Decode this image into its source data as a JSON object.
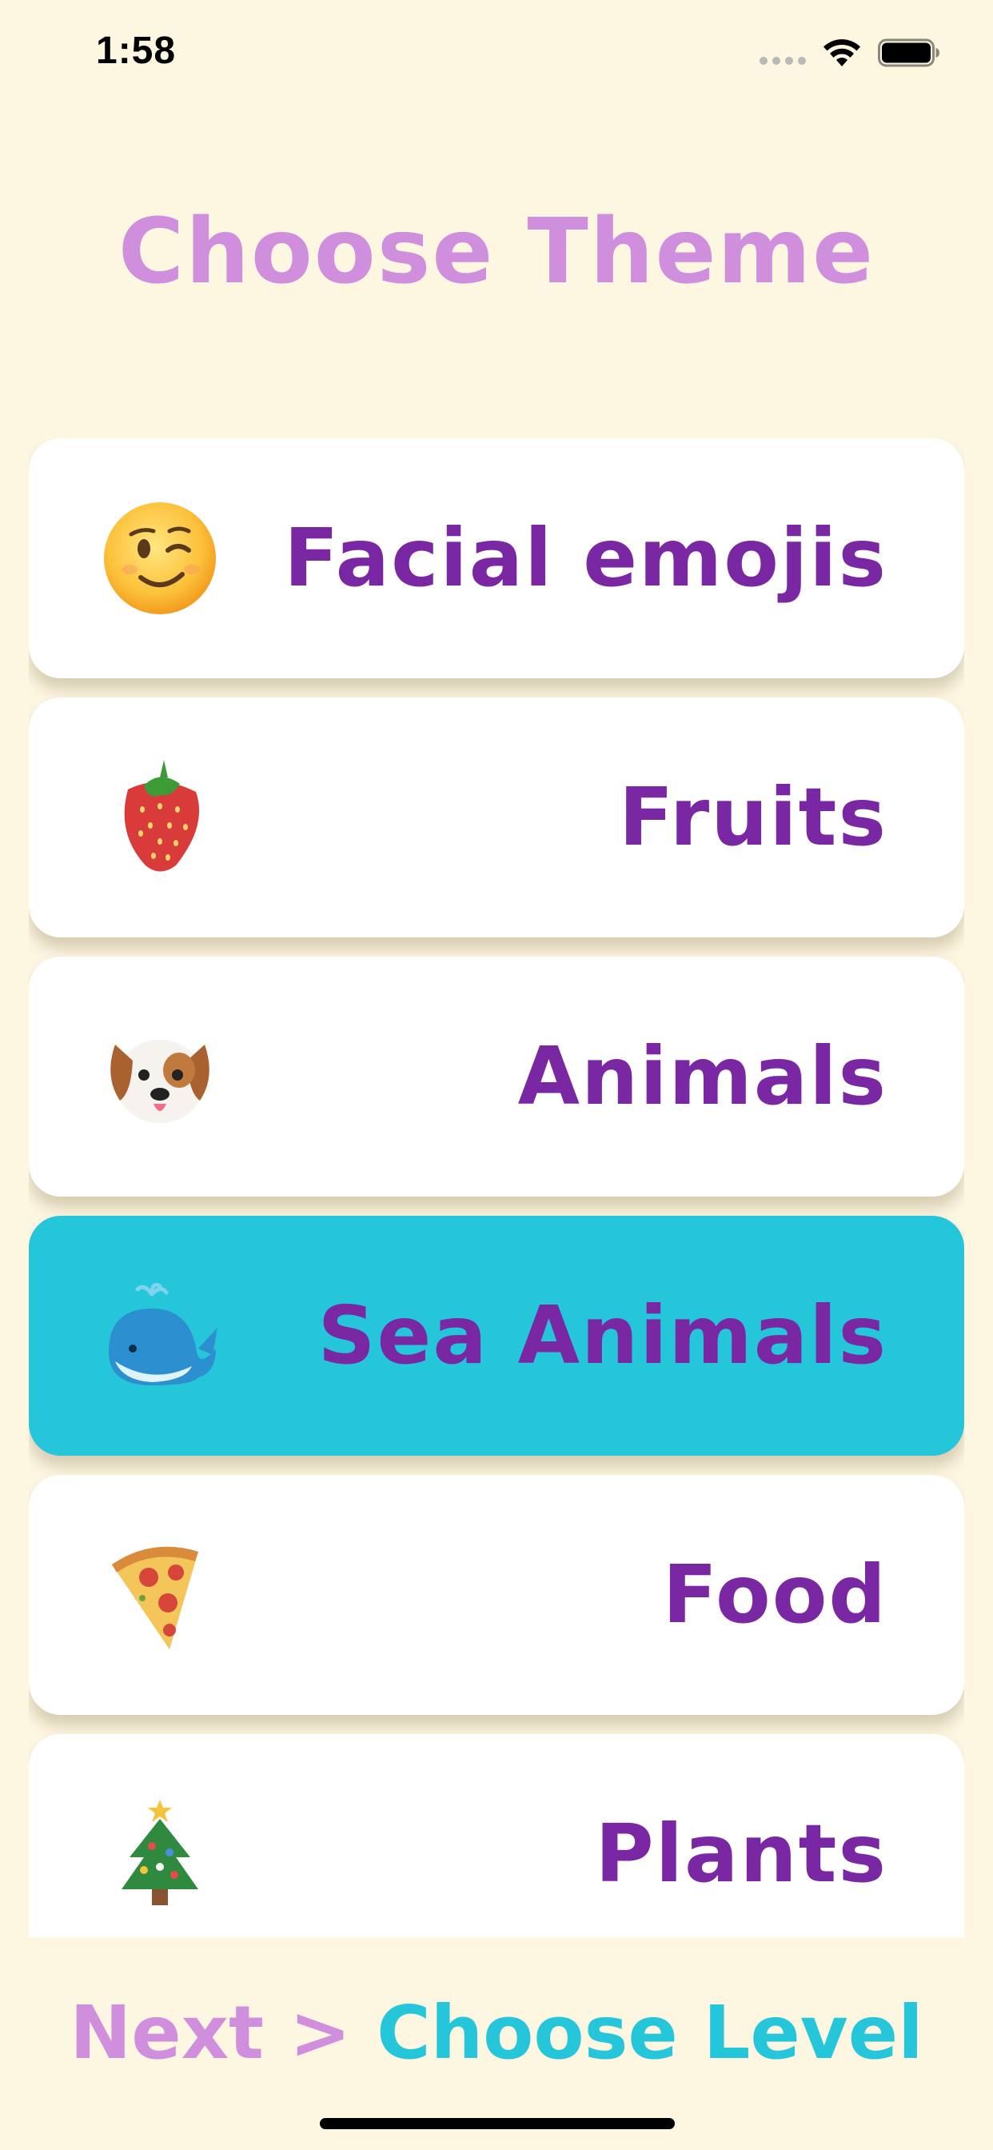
{
  "status_bar": {
    "time": "1:58",
    "icons": [
      "signal-dots-icon",
      "wifi-icon",
      "battery-icon"
    ]
  },
  "title": "Choose Theme",
  "themes": [
    {
      "label": "Facial emojis",
      "icon": "winking-face-icon",
      "selected": false
    },
    {
      "label": "Fruits",
      "icon": "strawberry-icon",
      "selected": false
    },
    {
      "label": "Animals",
      "icon": "dog-face-icon",
      "selected": false
    },
    {
      "label": "Sea Animals",
      "icon": "whale-icon",
      "selected": true
    },
    {
      "label": "Food",
      "icon": "pizza-icon",
      "selected": false
    },
    {
      "label": "Plants",
      "icon": "christmas-tree-icon",
      "selected": false
    }
  ],
  "next": {
    "prefix": "Next >",
    "target": "Choose Level"
  },
  "colors": {
    "background": "#fdf6e1",
    "title": "#d08fdc",
    "label": "#7a27a3",
    "selected_card": "#25c5da",
    "card": "#ffffff"
  }
}
